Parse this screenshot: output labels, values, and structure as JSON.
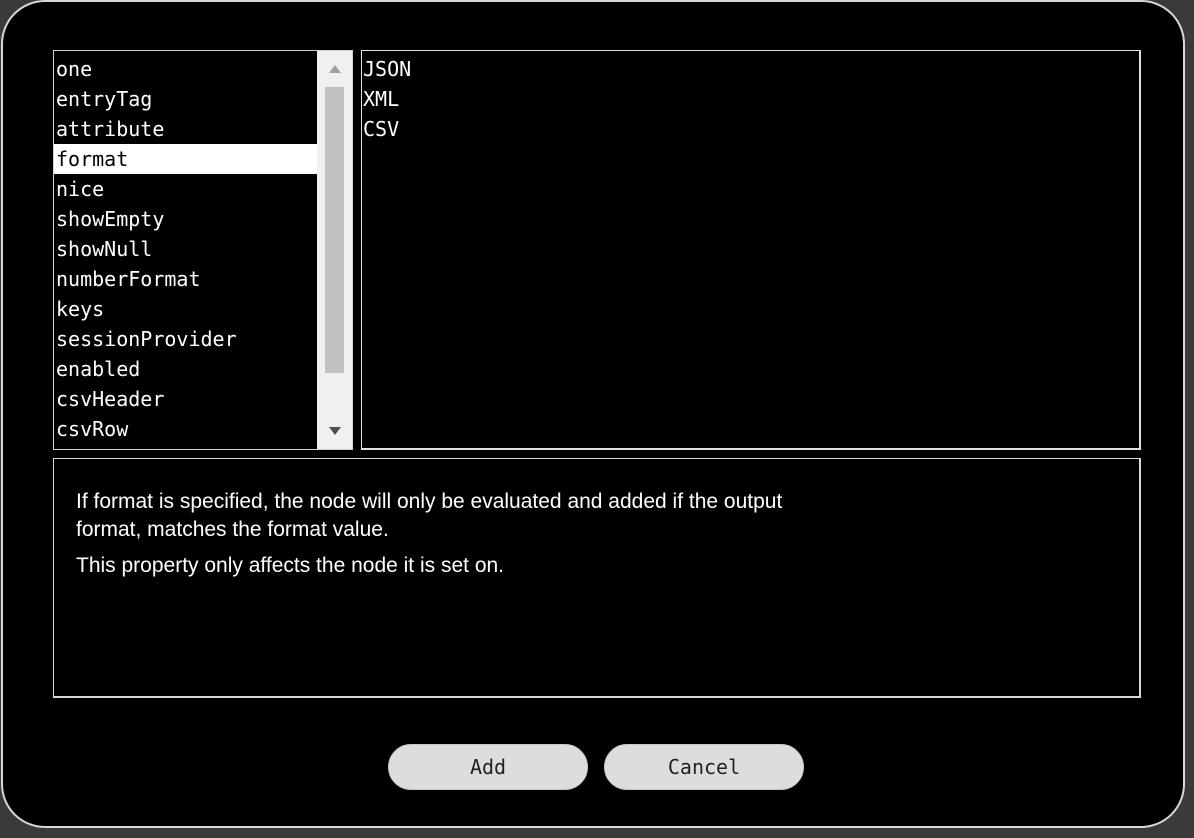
{
  "properties": {
    "items": [
      "one",
      "entryTag",
      "attribute",
      "format",
      "nice",
      "showEmpty",
      "showNull",
      "numberFormat",
      "keys",
      "sessionProvider",
      "enabled",
      "csvHeader",
      "csvRow"
    ],
    "selected_index": 3,
    "scroll_up_icon": "triangle-up-icon",
    "scroll_down_icon": "triangle-down-icon"
  },
  "values": {
    "items": [
      "JSON",
      "XML",
      "CSV"
    ]
  },
  "description": {
    "paragraph1": "If format is specified, the node will only be evaluated and added if the output format, matches the format value.",
    "paragraph2": "This property only affects the node it is set on."
  },
  "buttons": {
    "add_label": "Add",
    "cancel_label": "Cancel"
  },
  "colors": {
    "background": "#000000",
    "selection": "#ffffff",
    "button": "#dddddd"
  }
}
